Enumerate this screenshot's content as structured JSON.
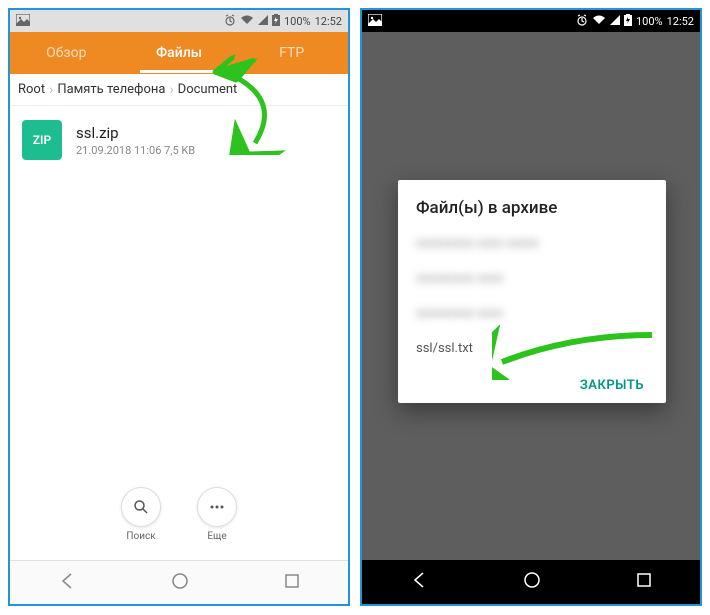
{
  "status": {
    "battery": "100%",
    "time": "12:52"
  },
  "left": {
    "tabs": {
      "overview": "Обзор",
      "files": "Файлы",
      "ftp": "FTP"
    },
    "breadcrumb": {
      "root": "Root",
      "mem": "Память телефона",
      "doc": "Document"
    },
    "file": {
      "badge": "ZIP",
      "name": "ssl.zip",
      "meta": "21.09.2018 11:06  7,5 KB"
    },
    "fabs": {
      "search": "Поиск",
      "more": "Еще"
    }
  },
  "right": {
    "dialog": {
      "title": "Файл(ы) в архиве",
      "items": {
        "a": "xxxxxxxxx xxxx xxxxx",
        "b": "xxxxxxxxx xxxx",
        "c": "xxxxxxxxx xxxx",
        "d": "ssl/ssl.txt"
      },
      "close": "ЗАКРЫТЬ"
    }
  }
}
